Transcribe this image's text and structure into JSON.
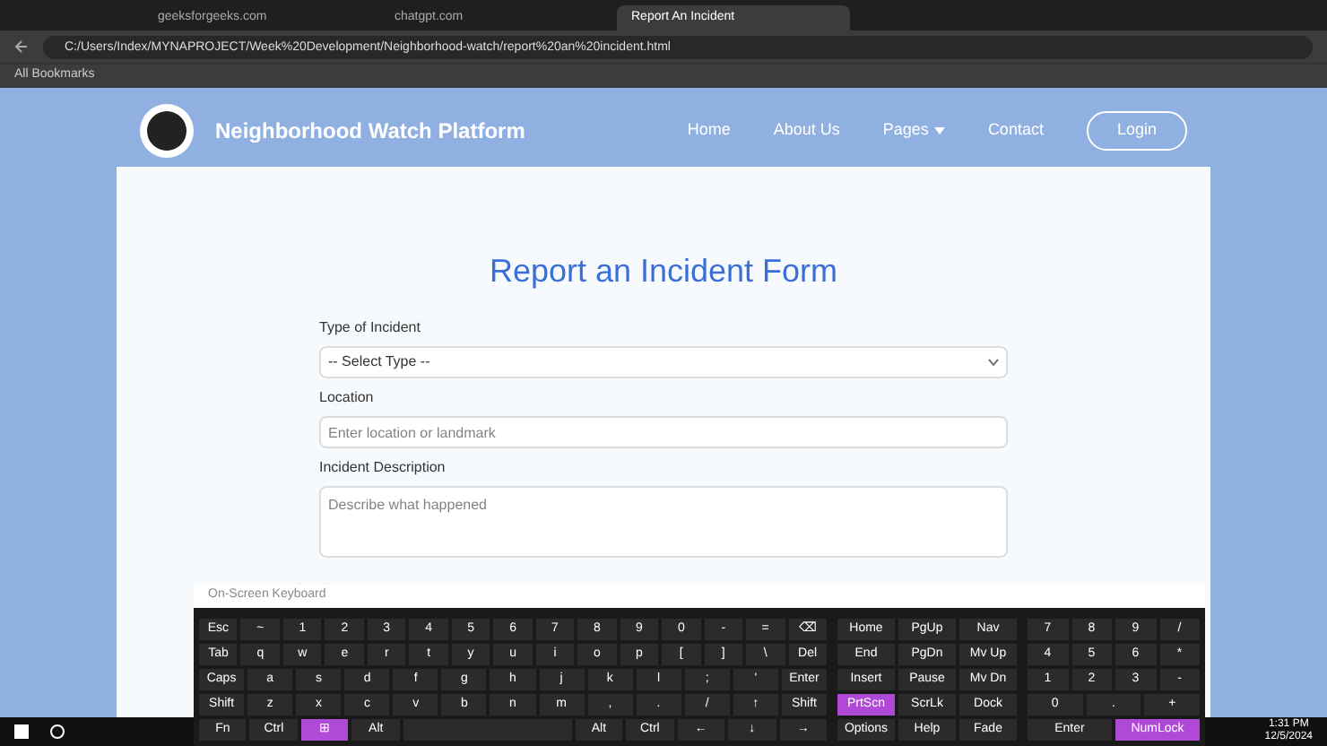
{
  "browser": {
    "tabs": [
      {
        "label": "geeksforgeeks.com",
        "selected": false
      },
      {
        "label": "chatgpt.com",
        "selected": false
      },
      {
        "label": "Report An Incident",
        "selected": true
      }
    ],
    "address": "C:/Users/Index/MYNAPROJECT/Week%20Development/Neighborhood-watch/report%20an%20incident.html",
    "bookmarks": [
      "All Bookmarks"
    ]
  },
  "navbar": {
    "brand": "Neighborhood Watch Platform",
    "links": [
      {
        "label": "Home",
        "dropdown": false
      },
      {
        "label": "About Us",
        "dropdown": false
      },
      {
        "label": "Pages",
        "dropdown": true
      },
      {
        "label": "Contact",
        "dropdown": false
      }
    ],
    "login": "Login"
  },
  "form": {
    "title": "Report an Incident Form",
    "fields": [
      {
        "kind": "select",
        "label": "Type of Incident",
        "value": "-- Select Type --"
      },
      {
        "kind": "input",
        "label": "Location",
        "placeholder": "Enter location or landmark"
      },
      {
        "kind": "textarea",
        "label": "Incident Description",
        "placeholder": "Describe what happened"
      }
    ]
  },
  "keyboard": {
    "title": "On-Screen Keyboard",
    "rows": [
      {
        "keys": [
          {
            "label": "Esc",
            "selected": false
          },
          {
            "label": "~",
            "selected": false
          },
          {
            "label": "1",
            "selected": false
          },
          {
            "label": "2",
            "selected": false
          },
          {
            "label": "3",
            "selected": false
          },
          {
            "label": "4",
            "selected": false
          },
          {
            "label": "5",
            "selected": false
          },
          {
            "label": "6",
            "selected": false
          },
          {
            "label": "7",
            "selected": false
          },
          {
            "label": "8",
            "selected": false
          },
          {
            "label": "9",
            "selected": false
          },
          {
            "label": "0",
            "selected": false
          },
          {
            "label": "-",
            "selected": false
          },
          {
            "label": "=",
            "selected": false
          },
          {
            "label": "⌫",
            "selected": false
          }
        ]
      },
      {
        "keys": [
          {
            "label": "Tab",
            "selected": false
          },
          {
            "label": "q",
            "selected": false
          },
          {
            "label": "w",
            "selected": false
          },
          {
            "label": "e",
            "selected": false
          },
          {
            "label": "r",
            "selected": false
          },
          {
            "label": "t",
            "selected": false
          },
          {
            "label": "y",
            "selected": false
          },
          {
            "label": "u",
            "selected": false
          },
          {
            "label": "i",
            "selected": false
          },
          {
            "label": "o",
            "selected": false
          },
          {
            "label": "p",
            "selected": false
          },
          {
            "label": "[",
            "selected": false
          },
          {
            "label": "]",
            "selected": false
          },
          {
            "label": "\\",
            "selected": false
          },
          {
            "label": "Del",
            "selected": false
          }
        ]
      },
      {
        "keys": [
          {
            "label": "Caps",
            "selected": false
          },
          {
            "label": "a",
            "selected": false
          },
          {
            "label": "s",
            "selected": false
          },
          {
            "label": "d",
            "selected": false
          },
          {
            "label": "f",
            "selected": false
          },
          {
            "label": "g",
            "selected": false
          },
          {
            "label": "h",
            "selected": false
          },
          {
            "label": "j",
            "selected": false
          },
          {
            "label": "k",
            "selected": false
          },
          {
            "label": "l",
            "selected": false
          },
          {
            "label": ";",
            "selected": false
          },
          {
            "label": "'",
            "selected": false
          },
          {
            "label": "Enter",
            "selected": false
          }
        ]
      },
      {
        "keys": [
          {
            "label": "Shift",
            "selected": false
          },
          {
            "label": "z",
            "selected": false
          },
          {
            "label": "x",
            "selected": false
          },
          {
            "label": "c",
            "selected": false
          },
          {
            "label": "v",
            "selected": false
          },
          {
            "label": "b",
            "selected": false
          },
          {
            "label": "n",
            "selected": false
          },
          {
            "label": "m",
            "selected": false
          },
          {
            "label": ",",
            "selected": false
          },
          {
            "label": ".",
            "selected": false
          },
          {
            "label": "/",
            "selected": false
          },
          {
            "label": "↑",
            "selected": false
          },
          {
            "label": "Shift",
            "selected": false
          }
        ]
      },
      {
        "keys": [
          {
            "label": "Fn",
            "selected": false
          },
          {
            "label": "Ctrl",
            "selected": false
          },
          {
            "label": "⊞",
            "selected": true
          },
          {
            "label": "Alt",
            "selected": false
          },
          {
            "kind": "space",
            "selected": false
          },
          {
            "label": "Alt",
            "selected": false
          },
          {
            "label": "Ctrl",
            "selected": false
          },
          {
            "label": "←",
            "selected": false
          },
          {
            "label": "↓",
            "selected": false
          },
          {
            "label": "→",
            "selected": false
          }
        ]
      }
    ],
    "nav_keys": [
      [
        {
          "label": "Home",
          "selected": false
        },
        {
          "label": "PgUp",
          "selected": false
        },
        {
          "label": "Nav",
          "selected": false
        }
      ],
      [
        {
          "label": "End",
          "selected": false
        },
        {
          "label": "PgDn",
          "selected": false
        },
        {
          "label": "Mv Up",
          "selected": false
        }
      ],
      [
        {
          "label": "Insert",
          "selected": false
        },
        {
          "label": "Pause",
          "selected": false
        },
        {
          "label": "Mv Dn",
          "selected": false
        }
      ],
      [
        {
          "label": "PrtScn",
          "selected": true
        },
        {
          "label": "ScrLk",
          "selected": false
        },
        {
          "label": "Dock",
          "selected": false
        }
      ],
      [
        {
          "label": "Options",
          "selected": false
        },
        {
          "label": "Help",
          "selected": false
        },
        {
          "label": "Fade",
          "selected": false
        }
      ]
    ],
    "numpad": [
      [
        {
          "label": "7",
          "selected": false
        },
        {
          "label": "8",
          "selected": false
        },
        {
          "label": "9",
          "selected": false
        },
        {
          "label": "/",
          "selected": false
        }
      ],
      [
        {
          "label": "4",
          "selected": false
        },
        {
          "label": "5",
          "selected": false
        },
        {
          "label": "6",
          "selected": false
        },
        {
          "label": "*",
          "selected": false
        }
      ],
      [
        {
          "label": "1",
          "selected": false
        },
        {
          "label": "2",
          "selected": false
        },
        {
          "label": "3",
          "selected": false
        },
        {
          "label": "-",
          "selected": false
        }
      ],
      [
        {
          "label": "0",
          "selected": false
        },
        {
          "label": ".",
          "selected": false
        },
        {
          "label": "+",
          "selected": false
        }
      ],
      [
        {
          "label": "Enter",
          "selected": false
        },
        {
          "label": "NumLock",
          "selected": true
        }
      ]
    ]
  },
  "taskbar": {
    "time": "1:31 PM",
    "date": "12/5/2024"
  }
}
